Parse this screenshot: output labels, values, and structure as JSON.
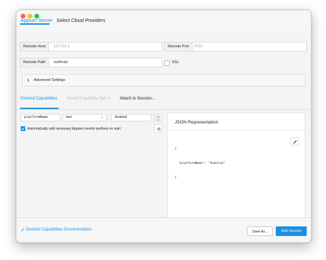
{
  "window": {
    "title_tabs": [
      "Appium Server",
      "Select Cloud Providers"
    ]
  },
  "tabs": {
    "server_label": "Appium Server",
    "cloud_label": "Select Cloud Providers"
  },
  "server": {
    "remote_host_label": "Remote Host",
    "remote_host_placeholder": "127.0.0.1",
    "remote_port_label": "Remote Port",
    "remote_port_placeholder": "4723",
    "remote_path_label": "Remote Path",
    "remote_path_value": "/wd/hub/",
    "ssl_label": "SSL",
    "advanced_label": "Advanced Settings"
  },
  "caps_tabs": {
    "desired": "Desired Capabilities",
    "saved": "Saved Capability Sets 0",
    "attach": "Attach to Session..."
  },
  "capability_row": {
    "name": "platformName",
    "type": "text",
    "value": "Android"
  },
  "auto_prefix_label": "Automatically add necessary Appium vendor prefixes on start",
  "json": {
    "title": "JSON Representation",
    "line1": "{",
    "line2": "  \"platformName\": \"Android\"",
    "line3": "}"
  },
  "footer": {
    "docs_link": "Desired Capabilities Documentation",
    "save_as": "Save As...",
    "start_session": "Start Session"
  },
  "colors": {
    "accent": "#1d8fe0",
    "close": "#fe5f57",
    "minimize": "#febc2e",
    "zoom": "#28c840"
  },
  "icons": [
    "chevron-right-icon",
    "chevron-down-icon",
    "trash-icon",
    "plus-icon",
    "edit-icon",
    "link-icon",
    "checkmark-icon"
  ]
}
